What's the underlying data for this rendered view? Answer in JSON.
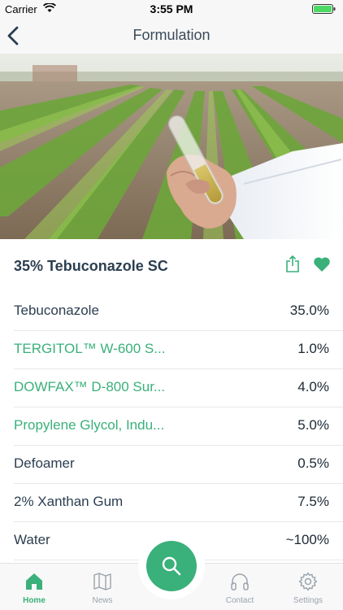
{
  "status_bar": {
    "carrier": "Carrier",
    "time": "3:55 PM"
  },
  "nav": {
    "title": "Formulation"
  },
  "product": {
    "name": "35% Tebuconazole SC"
  },
  "ingredients": [
    {
      "name": "Tebuconazole",
      "percent": "35.0%",
      "linked": false
    },
    {
      "name": "TERGITOL™ W-600 S...",
      "percent": "1.0%",
      "linked": true
    },
    {
      "name": "DOWFAX™ D-800 Sur...",
      "percent": "4.0%",
      "linked": true
    },
    {
      "name": "Propylene Glycol, Indu...",
      "percent": "5.0%",
      "linked": true
    },
    {
      "name": "Defoamer",
      "percent": "0.5%",
      "linked": false
    },
    {
      "name": "2% Xanthan Gum",
      "percent": "7.5%",
      "linked": false
    },
    {
      "name": "Water",
      "percent": "~100%",
      "linked": false
    }
  ],
  "tabs": [
    {
      "label": "Home",
      "icon": "home-icon",
      "active": true
    },
    {
      "label": "News",
      "icon": "map-icon",
      "active": false
    },
    {
      "label": "Contact",
      "icon": "headphones-icon",
      "active": false
    },
    {
      "label": "Settings",
      "icon": "gear-icon",
      "active": false
    }
  ],
  "colors": {
    "accent": "#3ab07a",
    "text": "#2c3e50",
    "inactive": "#9aa2ab"
  }
}
